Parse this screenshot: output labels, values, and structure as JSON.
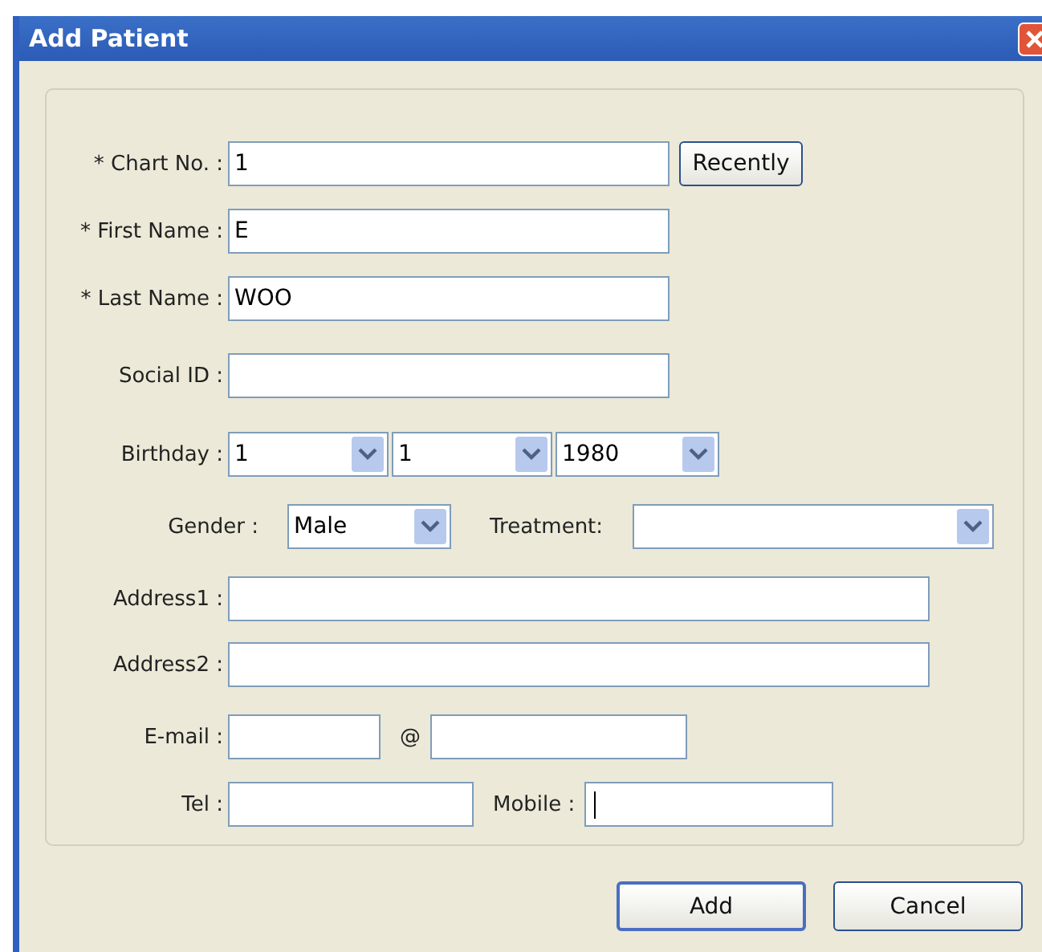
{
  "window": {
    "title": "Add Patient"
  },
  "rows": [
    {
      "items": [
        {
          "kind": "label",
          "text": "* Chart No. :"
        },
        {
          "kind": "text",
          "value": "1"
        },
        {
          "kind": "button",
          "label": "Recently"
        }
      ]
    },
    {
      "items": [
        {
          "kind": "label",
          "text": "* First Name :"
        },
        {
          "kind": "text",
          "value": "E"
        }
      ]
    },
    {
      "items": [
        {
          "kind": "label",
          "text": "* Last Name :"
        },
        {
          "kind": "text",
          "value": "WOO"
        }
      ]
    },
    {
      "items": [
        {
          "kind": "label",
          "text": "Social ID :"
        },
        {
          "kind": "text"
        }
      ]
    },
    {
      "items": [
        {
          "kind": "label",
          "text": "Birthday :"
        },
        {
          "kind": "select",
          "value": "1"
        },
        {
          "kind": "select",
          "value": "1"
        },
        {
          "kind": "select",
          "value": "1980"
        }
      ]
    },
    {
      "items": [
        {
          "kind": "label",
          "text": "Gender :"
        },
        {
          "kind": "select",
          "value": "Male"
        },
        {
          "kind": "label",
          "text": "Treatment:"
        },
        {
          "kind": "select"
        }
      ]
    },
    {
      "items": [
        {
          "kind": "label",
          "text": "Address1 :"
        },
        {
          "kind": "text"
        }
      ]
    },
    {
      "items": [
        {
          "kind": "label",
          "text": "Address2 :"
        },
        {
          "kind": "text"
        }
      ]
    },
    {
      "items": [
        {
          "kind": "label",
          "text": "E-mail :"
        },
        {
          "kind": "text"
        },
        {
          "kind": "label",
          "text": "@"
        },
        {
          "kind": "text"
        }
      ]
    },
    {
      "items": [
        {
          "kind": "label",
          "text": "Tel :"
        },
        {
          "kind": "text"
        },
        {
          "kind": "label",
          "text": "Mobile :"
        },
        {
          "kind": "text",
          "focused": true
        }
      ]
    }
  ],
  "buttons": [
    {
      "label": "Add",
      "default": true
    },
    {
      "label": "Cancel",
      "default": false
    }
  ]
}
